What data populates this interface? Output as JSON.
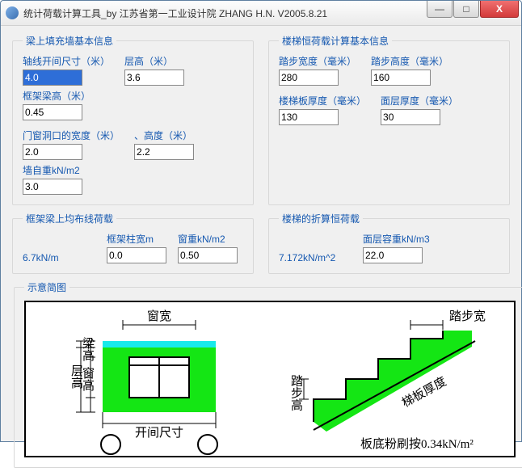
{
  "window": {
    "title": "统计荷载计算工具_by 江苏省第一工业设计院 ZHANG H.N.     V2005.8.21"
  },
  "groups": {
    "g1": {
      "legend": "梁上填充墙基本信息",
      "f": [
        {
          "label": "轴线开间尺寸（米）",
          "value": "4.0"
        },
        {
          "label": "层高（米）",
          "value": "3.6"
        },
        {
          "label": "框架梁高（米）",
          "value": "0.45"
        },
        {
          "label": "门窗洞口的宽度（米）",
          "value": "2.0"
        },
        {
          "label": "、高度（米）",
          "value": "2.2"
        },
        {
          "label": "墙自重kN/m2",
          "value": "3.0"
        }
      ]
    },
    "g2": {
      "legend": "楼梯恒荷载计算基本信息",
      "f": [
        {
          "label": "踏步宽度（毫米）",
          "value": "280"
        },
        {
          "label": "踏步高度（毫米）",
          "value": "160"
        },
        {
          "label": "楼梯板厚度（毫米）",
          "value": "130"
        },
        {
          "label": "面层厚度（毫米）",
          "value": "30"
        }
      ]
    },
    "g3": {
      "legend": "框架梁上均布线荷载",
      "static": "6.7kN/m",
      "f": [
        {
          "label": "框架柱宽m",
          "value": "0.0"
        },
        {
          "label": "窗重kN/m2",
          "value": "0.50"
        }
      ]
    },
    "g4": {
      "legend": "楼梯的折算恒荷载",
      "static": "7.172kN/m^2",
      "f": [
        {
          "label": "面层容重kN/m3",
          "value": "22.0"
        }
      ]
    }
  },
  "diagram": {
    "legend": "示意简图",
    "labels": {
      "l1": "窗宽",
      "l2": "开间尺寸",
      "l3": "层高",
      "l4": "梁高",
      "l5": "窗高",
      "l6": "踏步宽",
      "l7": "踏步高",
      "l8": "梯板厚度",
      "note": "板底粉刷按0.34kN/m²"
    }
  }
}
